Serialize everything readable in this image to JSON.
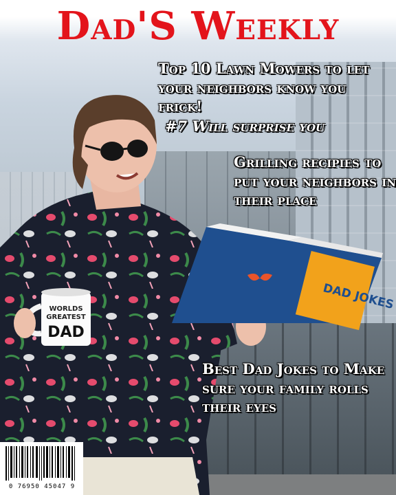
{
  "masthead": "Dad'S Weekly",
  "headlines": {
    "lawn_mowers": "Top 10 Lawn Mowers to let your neighbors know you frick!",
    "surprise": "#7 Will surprise you",
    "grilling": "Grilling recipies to put your neighbors in their place",
    "dad_jokes": "Best Dad Jokes to Make sure your family rolls their eyes"
  },
  "mug_text": {
    "line1": "WORLDS",
    "line2": "GREATEST",
    "line3": "DAD"
  },
  "book_cover": {
    "title": "DAD JOKES"
  },
  "barcode": {
    "number": "0 76950 45047 9"
  },
  "colors": {
    "masthead": "#e3141b",
    "headline_text": "#ffffff",
    "shirt": "#1a1f2e",
    "book": "#1f4f8f",
    "book_label": "#f2a21b"
  }
}
